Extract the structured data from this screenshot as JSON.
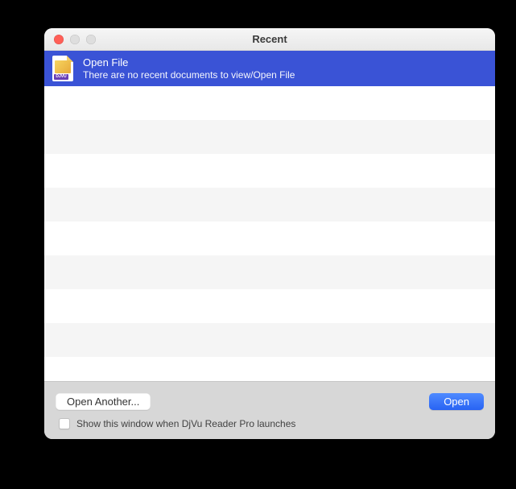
{
  "window": {
    "title": "Recent"
  },
  "selected": {
    "title": "Open File",
    "subtitle": "There are no recent documents to view/Open File"
  },
  "footer": {
    "open_another_label": "Open Another...",
    "open_label": "Open",
    "checkbox_label": "Show this window when DjVu Reader Pro launches"
  }
}
